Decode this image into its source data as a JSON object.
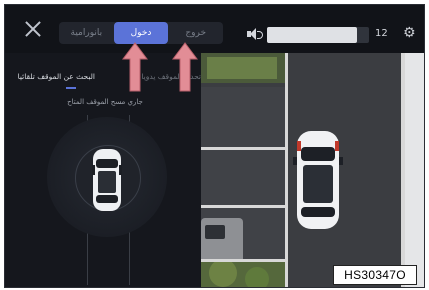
{
  "top_bar": {
    "modes": [
      "بانورامية",
      "دخول",
      "خروج"
    ],
    "active_mode_index": 1,
    "volume_fraction": 0.88,
    "volume_value": "12"
  },
  "panel": {
    "tabs": [
      "البحث عن الموقف تلقائيا",
      "تحديد الموقف يدويا"
    ],
    "status": "جاري مسح الموقف المتاح"
  },
  "image_code": "HS30347O",
  "colors": {
    "accent": "#5b73d8",
    "annotation_arrow": "#e28d96"
  }
}
